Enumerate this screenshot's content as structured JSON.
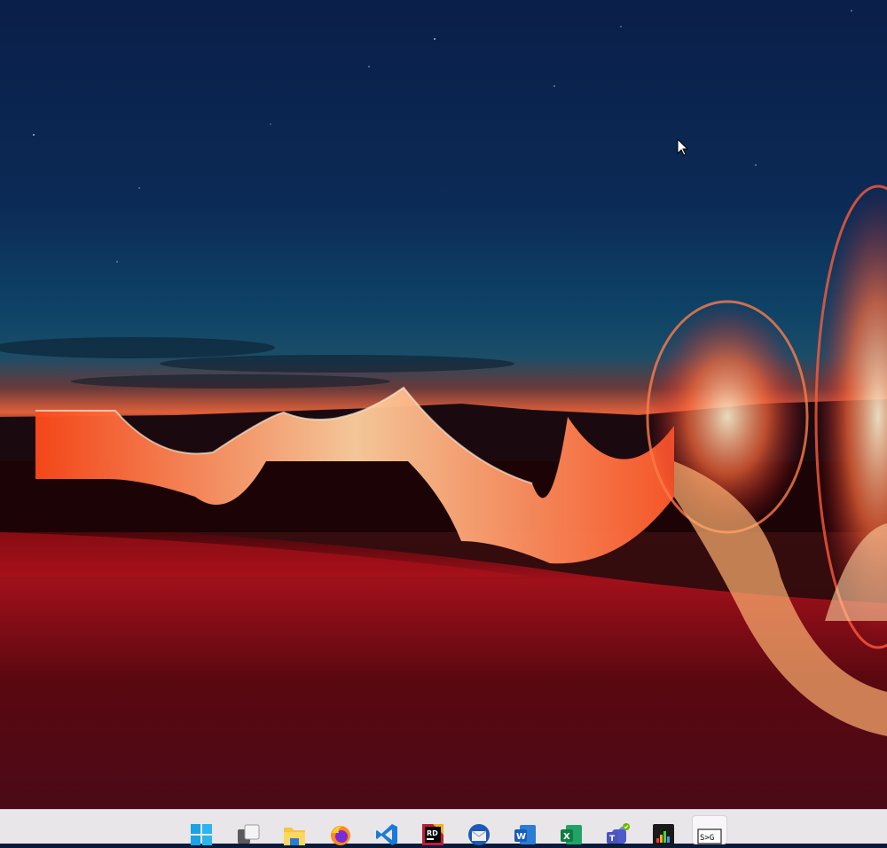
{
  "desktop": {
    "wallpaper": "light-painting-night-landscape",
    "colors": {
      "sky_top": "#0a1f4a",
      "sky_mid": "#0d3a5e",
      "horizon": "#e05a2a",
      "ground": "#5a0a12",
      "light_trail": "#ff5a2a"
    }
  },
  "cursor": {
    "icon": "mouse-pointer-icon"
  },
  "taskbar": {
    "background": "#e9e6e9",
    "apps": [
      {
        "name": "start-button",
        "icon": "windows-logo-icon"
      },
      {
        "name": "task-view-button",
        "icon": "task-view-icon"
      },
      {
        "name": "file-explorer-button",
        "icon": "folder-icon"
      },
      {
        "name": "firefox-button",
        "icon": "firefox-icon"
      },
      {
        "name": "vscode-button",
        "icon": "vscode-icon"
      },
      {
        "name": "rider-button",
        "icon": "rider-icon"
      },
      {
        "name": "thunderbird-button",
        "icon": "thunderbird-icon"
      },
      {
        "name": "word-button",
        "icon": "word-icon"
      },
      {
        "name": "excel-button",
        "icon": "excel-icon"
      },
      {
        "name": "teams-button",
        "icon": "teams-icon"
      },
      {
        "name": "equalizer-app-button",
        "icon": "equalizer-icon"
      },
      {
        "name": "terminal-app-button",
        "icon": "terminal-icon",
        "active": true
      }
    ],
    "labels": {
      "rider": "RD",
      "word": "W",
      "excel": "X",
      "teams": "T",
      "terminal": "S>G"
    }
  }
}
